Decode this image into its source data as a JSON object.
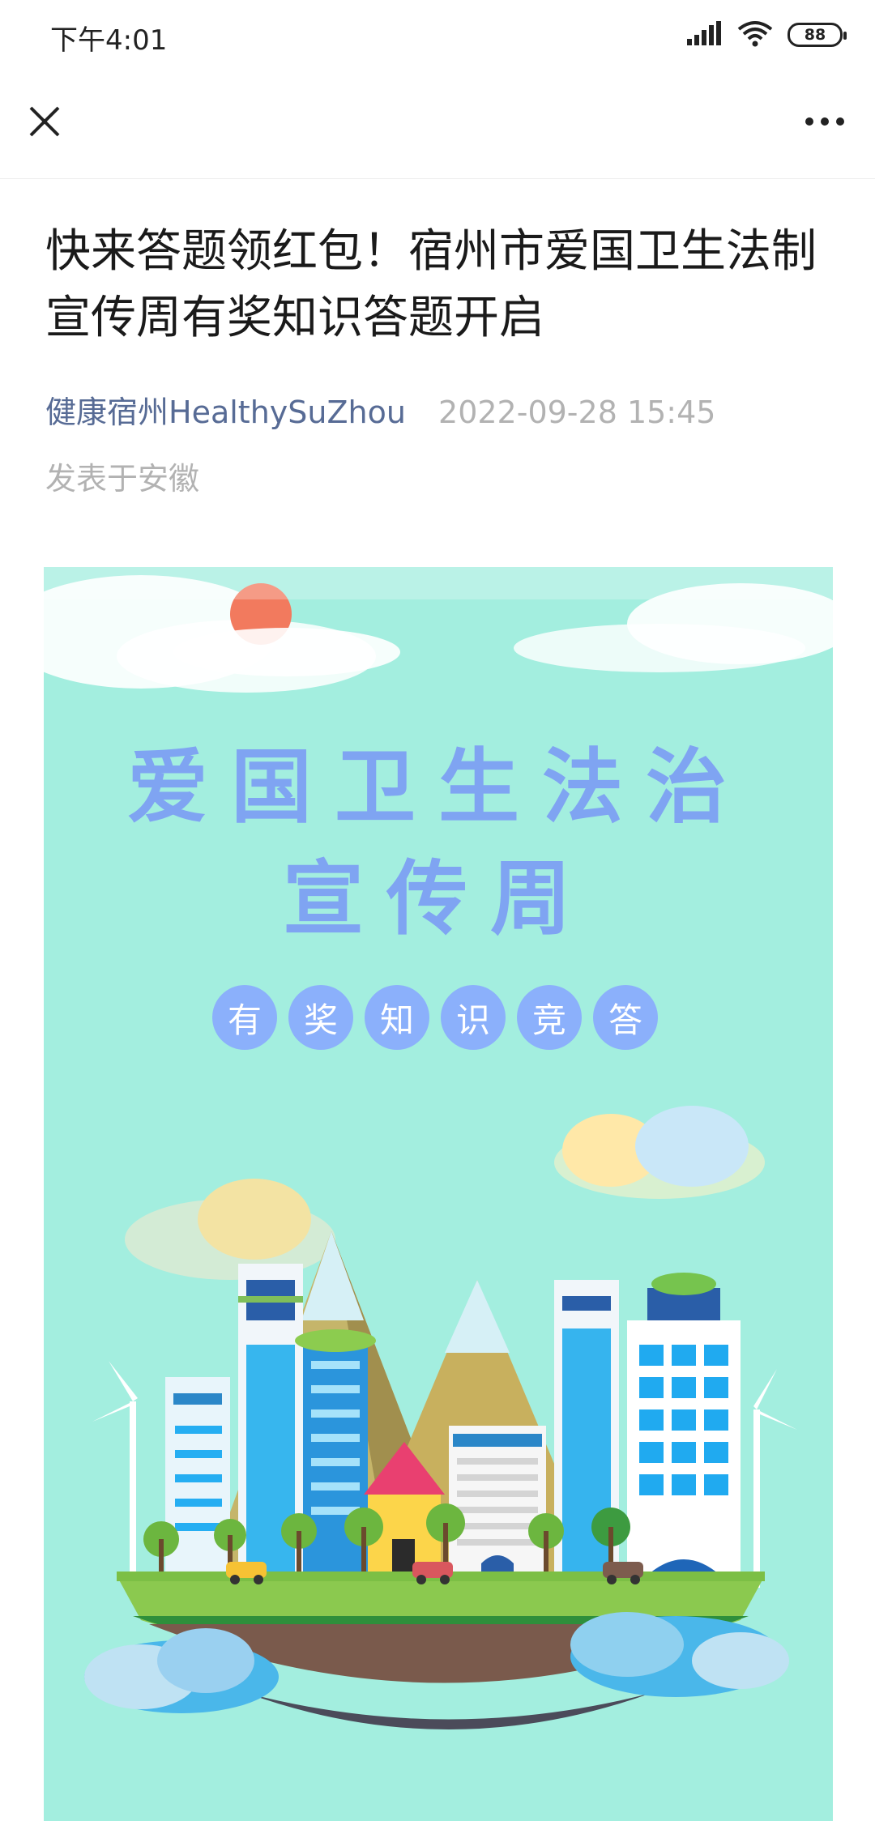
{
  "status_bar": {
    "time": "下午4:01",
    "battery": "88"
  },
  "nav": {
    "close_icon": "close-icon",
    "more_icon": "more-icon"
  },
  "article": {
    "title": "快来答题领红包！宿州市爱国卫生法制宣传周有奖知识答题开启",
    "author": "健康宿州HealthySuZhou",
    "date": "2022-09-28 15:45",
    "location": "发表于安徽"
  },
  "poster": {
    "title_line1": "爱国卫生法治",
    "title_line2": "宣传周",
    "chips": [
      "有",
      "奖",
      "知",
      "识",
      "竞",
      "答"
    ]
  },
  "colors": {
    "author": "#576b95",
    "poster_bg": "#a3eedf",
    "poster_title": "#7fa4f2",
    "chip_bg": "#8bb0fb"
  }
}
